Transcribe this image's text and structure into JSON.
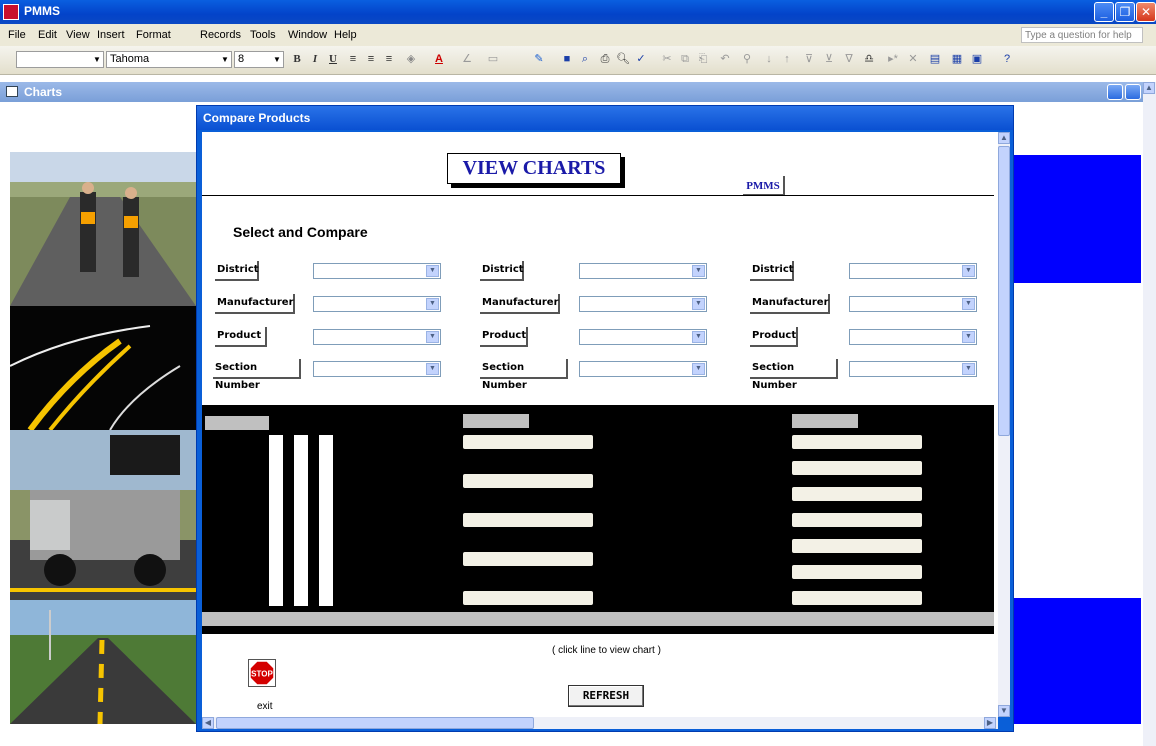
{
  "app": {
    "title": "PMMS",
    "window_buttons": [
      "_",
      "❐",
      "✕"
    ]
  },
  "menu": {
    "items": [
      "File",
      "Edit",
      "View",
      "Insert",
      "Format",
      "Records",
      "Tools",
      "Window",
      "Help"
    ],
    "help_placeholder": "Type a question for help"
  },
  "toolbar": {
    "font_name": "Tahoma",
    "font_size": "8",
    "bold": "B",
    "italic": "I",
    "underline": "U"
  },
  "charts_window": {
    "title": "Charts"
  },
  "dialog": {
    "title": "Compare Products",
    "heading": "VIEW CHARTS",
    "pmms_label": "PMMS",
    "select_title": "Select and Compare",
    "columns": [
      {
        "district": "District",
        "manufacturer": "Manufacturer",
        "product": "Product",
        "section": "Section Number"
      },
      {
        "district": "District",
        "manufacturer": "Manufacturer",
        "product": "Product",
        "section": "Section Number"
      },
      {
        "district": "District",
        "manufacturer": "Manufacturer",
        "product": "Product",
        "section": "Section Number"
      }
    ],
    "click_hint": "( click line to view chart )",
    "stop_label": "STOP",
    "exit_label": "exit",
    "refresh_label": "REFRESH"
  },
  "colors": {
    "xp_blue": "#0a5fd8",
    "accent_blue": "#0000ff",
    "heading_text": "#1a1aa8"
  }
}
